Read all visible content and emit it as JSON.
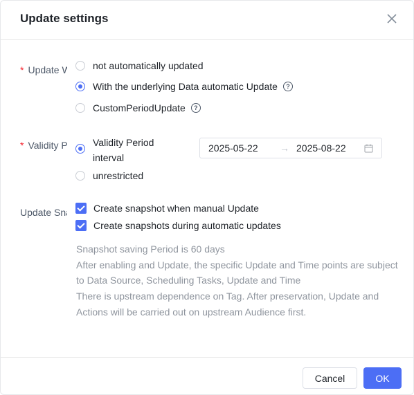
{
  "dialog": {
    "title": "Update settings"
  },
  "update_mode": {
    "label": "Update Way",
    "options": [
      {
        "label": "not automatically updated",
        "selected": false,
        "help": false
      },
      {
        "label": "With the underlying Data automatic Update",
        "selected": true,
        "help": true
      },
      {
        "label": "CustomPeriodUpdate",
        "selected": false,
        "help": true
      }
    ]
  },
  "validity": {
    "label": "Validity Period",
    "options": [
      {
        "label": "Validity Period interval",
        "selected": true
      },
      {
        "label": "unrestricted",
        "selected": false
      }
    ],
    "start_date": "2025-05-22",
    "end_date": "2025-08-22",
    "separator": "→"
  },
  "snapshot": {
    "label": "Update Snapshot",
    "options": [
      {
        "label": "Create snapshot when manual Update",
        "checked": true
      },
      {
        "label": "Create snapshots during automatic updates",
        "checked": true
      }
    ],
    "notes": [
      "Snapshot saving Period is 60 days",
      "After enabling and Update, the specific Update and Time points are subject to Data Source, Scheduling Tasks, Update and Time",
      "There is upstream dependence on Tag. After preservation, Update and Actions will be carried out on upstream Audience first."
    ]
  },
  "footer": {
    "cancel_label": "Cancel",
    "ok_label": "OK"
  },
  "colors": {
    "primary": "#4c6ef5",
    "required": "#f5222d",
    "muted": "#8f959e"
  }
}
